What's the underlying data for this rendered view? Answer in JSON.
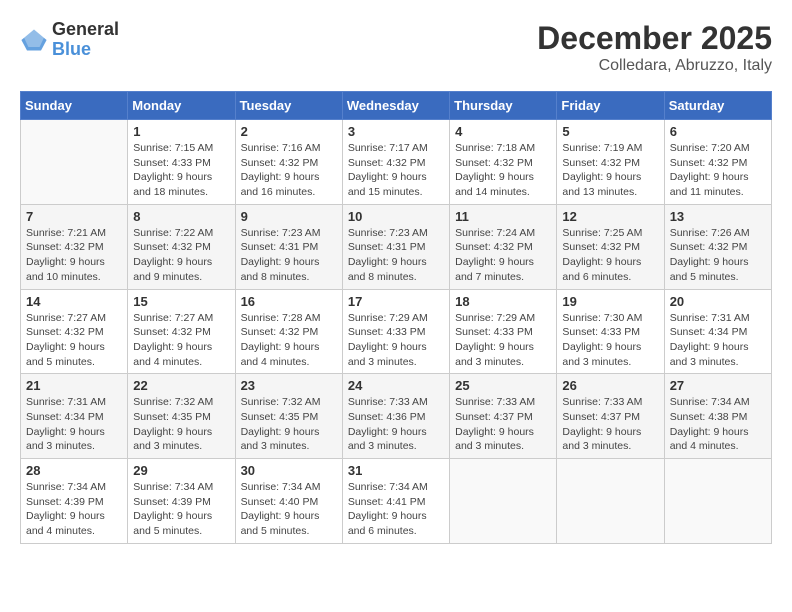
{
  "header": {
    "logo": {
      "general": "General",
      "blue": "Blue"
    },
    "title": "December 2025",
    "subtitle": "Colledara, Abruzzo, Italy"
  },
  "days_of_week": [
    "Sunday",
    "Monday",
    "Tuesday",
    "Wednesday",
    "Thursday",
    "Friday",
    "Saturday"
  ],
  "weeks": [
    [
      {
        "day": "",
        "info": ""
      },
      {
        "day": "1",
        "info": "Sunrise: 7:15 AM\nSunset: 4:33 PM\nDaylight: 9 hours\nand 18 minutes."
      },
      {
        "day": "2",
        "info": "Sunrise: 7:16 AM\nSunset: 4:32 PM\nDaylight: 9 hours\nand 16 minutes."
      },
      {
        "day": "3",
        "info": "Sunrise: 7:17 AM\nSunset: 4:32 PM\nDaylight: 9 hours\nand 15 minutes."
      },
      {
        "day": "4",
        "info": "Sunrise: 7:18 AM\nSunset: 4:32 PM\nDaylight: 9 hours\nand 14 minutes."
      },
      {
        "day": "5",
        "info": "Sunrise: 7:19 AM\nSunset: 4:32 PM\nDaylight: 9 hours\nand 13 minutes."
      },
      {
        "day": "6",
        "info": "Sunrise: 7:20 AM\nSunset: 4:32 PM\nDaylight: 9 hours\nand 11 minutes."
      }
    ],
    [
      {
        "day": "7",
        "info": "Sunrise: 7:21 AM\nSunset: 4:32 PM\nDaylight: 9 hours\nand 10 minutes."
      },
      {
        "day": "8",
        "info": "Sunrise: 7:22 AM\nSunset: 4:32 PM\nDaylight: 9 hours\nand 9 minutes."
      },
      {
        "day": "9",
        "info": "Sunrise: 7:23 AM\nSunset: 4:31 PM\nDaylight: 9 hours\nand 8 minutes."
      },
      {
        "day": "10",
        "info": "Sunrise: 7:23 AM\nSunset: 4:31 PM\nDaylight: 9 hours\nand 8 minutes."
      },
      {
        "day": "11",
        "info": "Sunrise: 7:24 AM\nSunset: 4:32 PM\nDaylight: 9 hours\nand 7 minutes."
      },
      {
        "day": "12",
        "info": "Sunrise: 7:25 AM\nSunset: 4:32 PM\nDaylight: 9 hours\nand 6 minutes."
      },
      {
        "day": "13",
        "info": "Sunrise: 7:26 AM\nSunset: 4:32 PM\nDaylight: 9 hours\nand 5 minutes."
      }
    ],
    [
      {
        "day": "14",
        "info": "Sunrise: 7:27 AM\nSunset: 4:32 PM\nDaylight: 9 hours\nand 5 minutes."
      },
      {
        "day": "15",
        "info": "Sunrise: 7:27 AM\nSunset: 4:32 PM\nDaylight: 9 hours\nand 4 minutes."
      },
      {
        "day": "16",
        "info": "Sunrise: 7:28 AM\nSunset: 4:32 PM\nDaylight: 9 hours\nand 4 minutes."
      },
      {
        "day": "17",
        "info": "Sunrise: 7:29 AM\nSunset: 4:33 PM\nDaylight: 9 hours\nand 3 minutes."
      },
      {
        "day": "18",
        "info": "Sunrise: 7:29 AM\nSunset: 4:33 PM\nDaylight: 9 hours\nand 3 minutes."
      },
      {
        "day": "19",
        "info": "Sunrise: 7:30 AM\nSunset: 4:33 PM\nDaylight: 9 hours\nand 3 minutes."
      },
      {
        "day": "20",
        "info": "Sunrise: 7:31 AM\nSunset: 4:34 PM\nDaylight: 9 hours\nand 3 minutes."
      }
    ],
    [
      {
        "day": "21",
        "info": "Sunrise: 7:31 AM\nSunset: 4:34 PM\nDaylight: 9 hours\nand 3 minutes."
      },
      {
        "day": "22",
        "info": "Sunrise: 7:32 AM\nSunset: 4:35 PM\nDaylight: 9 hours\nand 3 minutes."
      },
      {
        "day": "23",
        "info": "Sunrise: 7:32 AM\nSunset: 4:35 PM\nDaylight: 9 hours\nand 3 minutes."
      },
      {
        "day": "24",
        "info": "Sunrise: 7:33 AM\nSunset: 4:36 PM\nDaylight: 9 hours\nand 3 minutes."
      },
      {
        "day": "25",
        "info": "Sunrise: 7:33 AM\nSunset: 4:37 PM\nDaylight: 9 hours\nand 3 minutes."
      },
      {
        "day": "26",
        "info": "Sunrise: 7:33 AM\nSunset: 4:37 PM\nDaylight: 9 hours\nand 3 minutes."
      },
      {
        "day": "27",
        "info": "Sunrise: 7:34 AM\nSunset: 4:38 PM\nDaylight: 9 hours\nand 4 minutes."
      }
    ],
    [
      {
        "day": "28",
        "info": "Sunrise: 7:34 AM\nSunset: 4:39 PM\nDaylight: 9 hours\nand 4 minutes."
      },
      {
        "day": "29",
        "info": "Sunrise: 7:34 AM\nSunset: 4:39 PM\nDaylight: 9 hours\nand 5 minutes."
      },
      {
        "day": "30",
        "info": "Sunrise: 7:34 AM\nSunset: 4:40 PM\nDaylight: 9 hours\nand 5 minutes."
      },
      {
        "day": "31",
        "info": "Sunrise: 7:34 AM\nSunset: 4:41 PM\nDaylight: 9 hours\nand 6 minutes."
      },
      {
        "day": "",
        "info": ""
      },
      {
        "day": "",
        "info": ""
      },
      {
        "day": "",
        "info": ""
      }
    ]
  ]
}
